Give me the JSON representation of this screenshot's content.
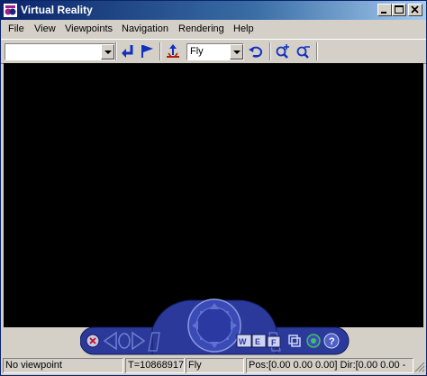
{
  "window": {
    "title": "Virtual Reality"
  },
  "menu": {
    "items": [
      "File",
      "View",
      "Viewpoints",
      "Navigation",
      "Rendering",
      "Help"
    ]
  },
  "toolbar": {
    "viewpoint_combo_value": "",
    "nav_mode_value": "Fly",
    "icons": [
      "return-arrow-icon",
      "flag-icon",
      "straighten-up-icon",
      "undo-move-icon",
      "zoom-in-icon",
      "zoom-out-icon"
    ]
  },
  "nav_panel": {
    "mode_buttons": [
      "W",
      "E",
      "F"
    ],
    "help_label": "?"
  },
  "status": {
    "viewpoint": "No viewpoint",
    "time": "T=10868917",
    "mode": "Fly",
    "pos_dir": "Pos:[0.00 0.00 0.00] Dir:[0.00 0.00 -"
  },
  "colors": {
    "canvas": "#000000",
    "nav_blue": "#2b3a9a",
    "title_start": "#0a246a"
  }
}
